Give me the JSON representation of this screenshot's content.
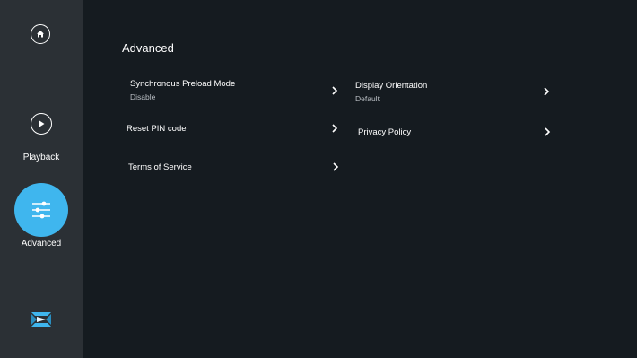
{
  "sidebar": {
    "home_icon": "home-icon",
    "items": [
      {
        "label": "Playback",
        "icon": "play-circle-icon",
        "active": false
      },
      {
        "label": "Advanced",
        "icon": "sliders-icon",
        "active": true
      }
    ],
    "logo_icon": "app-logo-icon",
    "active_color": "#3fb6ee"
  },
  "main": {
    "title": "Advanced",
    "settings": [
      {
        "label": "Synchronous Preload Mode",
        "value": "Disable"
      },
      {
        "label": "Display Orientation",
        "value": "Default"
      },
      {
        "label": "Reset PIN code"
      },
      {
        "label": "Privacy Policy"
      },
      {
        "label": "Terms of Service"
      }
    ]
  }
}
